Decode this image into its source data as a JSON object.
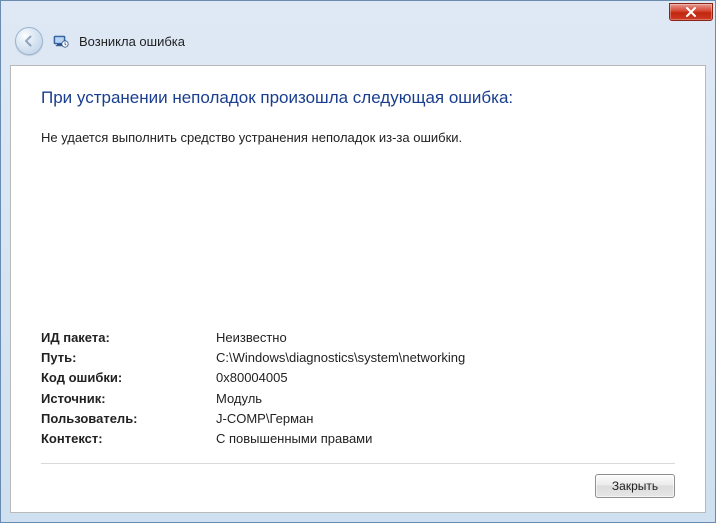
{
  "window": {
    "title": "Возникла ошибка"
  },
  "heading": "При устранении неполадок произошла следующая ошибка:",
  "message": "Не удается выполнить средство устранения неполадок из-за ошибки.",
  "details": [
    {
      "label": "ИД пакета:",
      "value": "Неизвестно"
    },
    {
      "label": "Путь:",
      "value": "C:\\Windows\\diagnostics\\system\\networking"
    },
    {
      "label": "Код ошибки:",
      "value": "0x80004005"
    },
    {
      "label": "Источник:",
      "value": "Модуль"
    },
    {
      "label": "Пользователь:",
      "value": "J-COMP\\Герман"
    },
    {
      "label": "Контекст:",
      "value": "С повышенными правами"
    }
  ],
  "buttons": {
    "close": "Закрыть"
  }
}
